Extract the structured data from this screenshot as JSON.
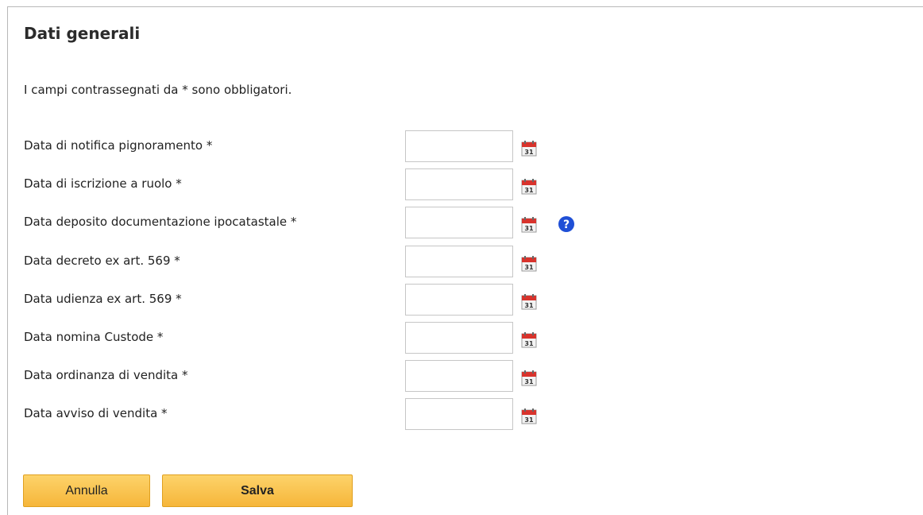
{
  "section": {
    "title": "Dati generali",
    "required_note": "I campi contrassegnati da * sono obbligatori."
  },
  "fields": [
    {
      "label": "Data di notifica pignoramento *",
      "value": "",
      "has_help": false
    },
    {
      "label": "Data di iscrizione a ruolo *",
      "value": "",
      "has_help": false
    },
    {
      "label": "Data deposito documentazione ipocatastale *",
      "value": "",
      "has_help": true
    },
    {
      "label": "Data decreto ex art. 569 *",
      "value": "",
      "has_help": false
    },
    {
      "label": "Data udienza ex art. 569 *",
      "value": "",
      "has_help": false
    },
    {
      "label": "Data nomina Custode *",
      "value": "",
      "has_help": false
    },
    {
      "label": "Data ordinanza di vendita *",
      "value": "",
      "has_help": false
    },
    {
      "label": "Data avviso di vendita *",
      "value": "",
      "has_help": false
    }
  ],
  "icons": {
    "calendar": "calendar-icon",
    "calendar_day": "31",
    "help": "help-icon"
  },
  "buttons": {
    "cancel_label": "Annulla",
    "save_label": "Salva"
  },
  "colors": {
    "button_gradient_top": "#fdd36a",
    "button_gradient_bottom": "#f6b63a",
    "help_blue": "#1f4fd6",
    "calendar_red": "#d8332c"
  }
}
